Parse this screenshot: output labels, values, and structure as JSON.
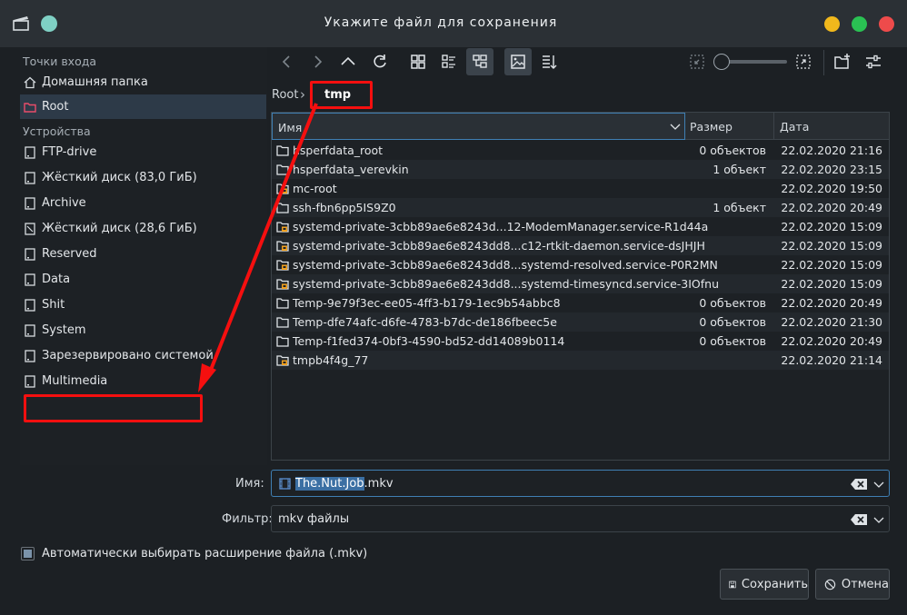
{
  "window": {
    "title": "Укажите файл для сохранения"
  },
  "sidebar": {
    "places_title": "Точки входа",
    "devices_title": "Устройства",
    "places": [
      {
        "label": "Домашняя папка",
        "icon": "home-icon"
      },
      {
        "label": "Root",
        "icon": "folder-red-icon",
        "selected": true
      }
    ],
    "devices": [
      {
        "label": "FTP-drive",
        "icon": "drive-icon"
      },
      {
        "label": "Жёсткий диск (83,0 ГиБ)",
        "icon": "drive-icon"
      },
      {
        "label": "Archive",
        "icon": "drive-icon"
      },
      {
        "label": "Жёсткий диск (28,6 ГиБ)",
        "icon": "drive-icon"
      },
      {
        "label": "Reserved",
        "icon": "drive-icon"
      },
      {
        "label": "Data",
        "icon": "drive-icon"
      },
      {
        "label": "Shit",
        "icon": "drive-icon"
      },
      {
        "label": "System",
        "icon": "drive-icon"
      },
      {
        "label": "Зарезервировано системой",
        "icon": "drive-icon"
      },
      {
        "label": "Multimedia",
        "icon": "drive-icon"
      }
    ]
  },
  "toolbar": {
    "buttons": [
      "back-icon",
      "forward-icon",
      "up-icon",
      "reload-icon",
      "icons-view-icon",
      "compact-view-icon",
      "tree-view-icon",
      "preview-icon",
      "sort-icon",
      "zoom-out-icon",
      "zoom-in-icon",
      "new-folder-icon",
      "options-icon"
    ]
  },
  "breadcrumb": {
    "root": "Root",
    "current": "tmp"
  },
  "filelist": {
    "columns": {
      "name": "Имя",
      "size": "Размер",
      "date": "Дата"
    },
    "rows": [
      {
        "name": "hsperfdata_root",
        "size": "0 объектов",
        "date": "22.02.2020 21:16",
        "icon": "folder-icon"
      },
      {
        "name": "hsperfdata_verevkin",
        "size": "1 объект",
        "date": "22.02.2020 23:15",
        "icon": "folder-icon"
      },
      {
        "name": "mc-root",
        "size": "",
        "date": "22.02.2020 19:50",
        "icon": "folder-locked-icon"
      },
      {
        "name": "ssh-fbn6pp5IS9Z0",
        "size": "1 объект",
        "date": "22.02.2020 20:49",
        "icon": "folder-icon"
      },
      {
        "name": "systemd-private-3cbb89ae6e8243d...12-ModemManager.service-R1d44a",
        "size": "",
        "date": "22.02.2020 15:09",
        "icon": "folder-locked-icon"
      },
      {
        "name": "systemd-private-3cbb89ae6e8243dd8...c12-rtkit-daemon.service-dsJHJH",
        "size": "",
        "date": "22.02.2020 15:09",
        "icon": "folder-locked-icon"
      },
      {
        "name": "systemd-private-3cbb89ae6e8243dd8...systemd-resolved.service-P0R2MN",
        "size": "",
        "date": "22.02.2020 15:09",
        "icon": "folder-locked-icon"
      },
      {
        "name": "systemd-private-3cbb89ae6e8243dd8...systemd-timesyncd.service-3IOfnu",
        "size": "",
        "date": "22.02.2020 15:09",
        "icon": "folder-locked-icon"
      },
      {
        "name": "Temp-9e79f3ec-ee05-4ff3-b179-1ec9b54abbc8",
        "size": "0 объектов",
        "date": "22.02.2020 20:49",
        "icon": "folder-icon"
      },
      {
        "name": "Temp-dfe74afc-d6fe-4783-b7dc-de186fbeec5e",
        "size": "0 объектов",
        "date": "22.02.2020 21:30",
        "icon": "folder-icon"
      },
      {
        "name": "Temp-f1fed374-0bf3-4590-bd52-dd14089b0114",
        "size": "0 объектов",
        "date": "22.02.2020 20:49",
        "icon": "folder-icon"
      },
      {
        "name": "tmpb4f4g_77",
        "size": "",
        "date": "22.02.2020 21:14",
        "icon": "folder-locked-icon"
      }
    ]
  },
  "filename": {
    "label": "Имя:",
    "value_selected": "The.Nut.Job",
    "value_ext": ".mkv"
  },
  "filter": {
    "label": "Фильтр:",
    "value": "mkv файлы"
  },
  "auto_extension": {
    "label": "Автоматически выбирать расширение файла (.mkv)",
    "checked": true
  },
  "buttons": {
    "save": "Сохранить",
    "cancel": "Отмена"
  },
  "colors": {
    "annotation": "#f50f0f",
    "selection": "#3b6fa3",
    "accent": "#3f7fb3"
  }
}
